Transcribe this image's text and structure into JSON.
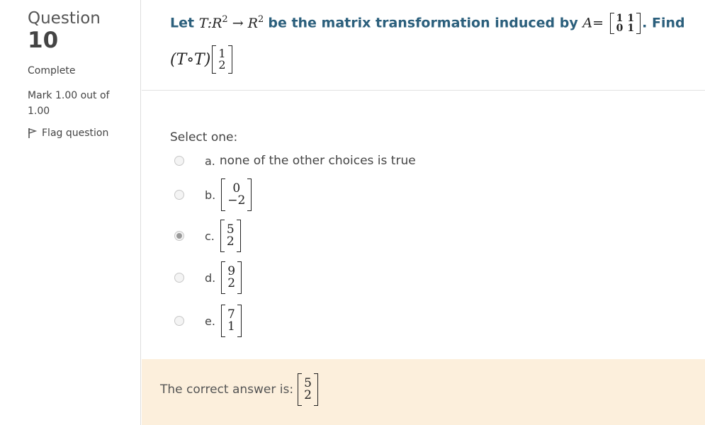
{
  "sidebar": {
    "question_word": "Question",
    "question_number": "10",
    "state": "Complete",
    "mark": "Mark 1.00 out of 1.00",
    "flag_label": "Flag question"
  },
  "question": {
    "prefix": "Let",
    "mapping_left": "T:R",
    "mapping_right": "R",
    "power": "2",
    "arrow": "→",
    "middle": "be the matrix transformation induced by",
    "matrix_name": "A",
    "equals": "=",
    "matrix_A": [
      [
        "1",
        "1"
      ],
      [
        "0",
        "1"
      ]
    ],
    "suffix": ". Find",
    "composition": "(T∘T)",
    "vector": [
      "1",
      "2"
    ]
  },
  "prompt": "Select one:",
  "options": [
    {
      "letter": "a.",
      "text": "none of the other choices is true",
      "checked": false
    },
    {
      "letter": "b.",
      "vector": [
        "0",
        "−2"
      ],
      "checked": false
    },
    {
      "letter": "c.",
      "vector": [
        "5",
        "2"
      ],
      "checked": true
    },
    {
      "letter": "d.",
      "vector": [
        "9",
        "2"
      ],
      "checked": false
    },
    {
      "letter": "e.",
      "vector": [
        "7",
        "1"
      ],
      "checked": false
    }
  ],
  "feedback": {
    "label": "The correct answer is:",
    "vector": [
      "5",
      "2"
    ]
  }
}
